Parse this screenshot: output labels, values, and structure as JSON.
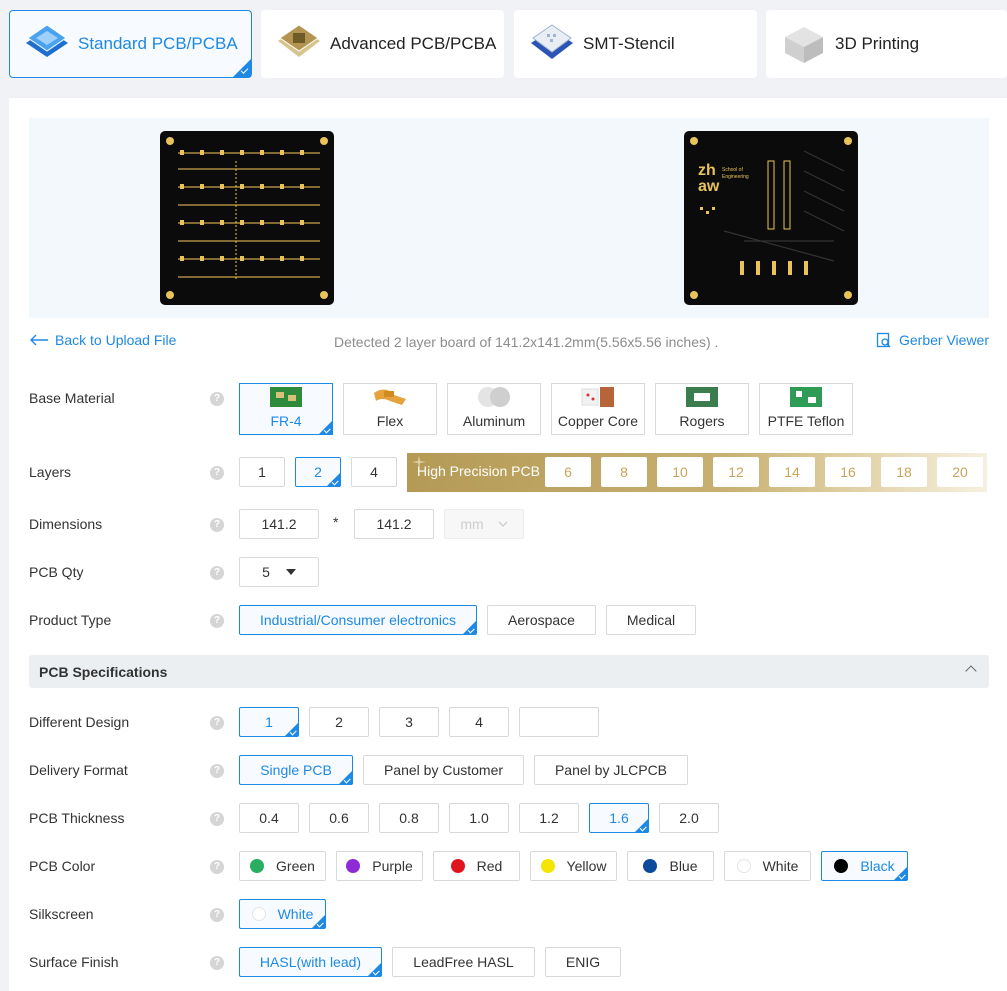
{
  "tabs": [
    {
      "label": "Standard PCB/PCBA",
      "icon": "pcb-stack-icon",
      "active": true
    },
    {
      "label": "Advanced PCB/PCBA",
      "icon": "gold-chip-icon",
      "active": false
    },
    {
      "label": "SMT-Stencil",
      "icon": "stencil-icon",
      "active": false
    },
    {
      "label": "3D Printing",
      "icon": "cube-icon",
      "active": false
    }
  ],
  "preview": {
    "back_board_text": "zh aw School of Engineering"
  },
  "toolbar": {
    "back_link": "Back to Upload File",
    "detected_text": "Detected 2 layer board of 141.2x141.2mm(5.56x5.56 inches) .",
    "gerber_viewer": "Gerber Viewer"
  },
  "form": {
    "base_material": {
      "label": "Base Material",
      "options": [
        "FR-4",
        "Flex",
        "Aluminum",
        "Copper Core",
        "Rogers",
        "PTFE Teflon"
      ],
      "selected": "FR-4"
    },
    "layers": {
      "label": "Layers",
      "options": [
        "1",
        "2",
        "4"
      ],
      "selected": "2",
      "high_precision_label": "High Precision PCB",
      "high_precision_options": [
        "6",
        "8",
        "10",
        "12",
        "14",
        "16",
        "18",
        "20"
      ]
    },
    "dimensions": {
      "label": "Dimensions",
      "width": "141.2",
      "height": "141.2",
      "separator": "*",
      "unit": "mm"
    },
    "pcb_qty": {
      "label": "PCB Qty",
      "value": "5"
    },
    "product_type": {
      "label": "Product Type",
      "options": [
        "Industrial/Consumer electronics",
        "Aerospace",
        "Medical"
      ],
      "selected": "Industrial/Consumer electronics"
    }
  },
  "specs": {
    "section_title": "PCB Specifications",
    "different_design": {
      "label": "Different Design",
      "options": [
        "1",
        "2",
        "3",
        "4",
        ""
      ],
      "selected": "1"
    },
    "delivery_format": {
      "label": "Delivery Format",
      "options": [
        "Single PCB",
        "Panel by Customer",
        "Panel by JLCPCB"
      ],
      "selected": "Single PCB"
    },
    "pcb_thickness": {
      "label": "PCB Thickness",
      "options": [
        "0.4",
        "0.6",
        "0.8",
        "1.0",
        "1.2",
        "1.6",
        "2.0"
      ],
      "selected": "1.6"
    },
    "pcb_color": {
      "label": "PCB Color",
      "options": [
        {
          "name": "Green",
          "color": "#27ae60"
        },
        {
          "name": "Purple",
          "color": "#8e2bd6"
        },
        {
          "name": "Red",
          "color": "#e0141e"
        },
        {
          "name": "Yellow",
          "color": "#f5e400"
        },
        {
          "name": "Blue",
          "color": "#0c4a9e"
        },
        {
          "name": "White",
          "color": "#ffffff"
        },
        {
          "name": "Black",
          "color": "#000000"
        }
      ],
      "selected": "Black"
    },
    "silkscreen": {
      "label": "Silkscreen",
      "value": "White"
    },
    "surface_finish": {
      "label": "Surface Finish",
      "options": [
        "HASL(with lead)",
        "LeadFree HASL",
        "ENIG"
      ],
      "selected": "HASL(with lead)"
    }
  },
  "colors": {
    "accent": "#1e88e5",
    "gold": "#c8a45a"
  }
}
